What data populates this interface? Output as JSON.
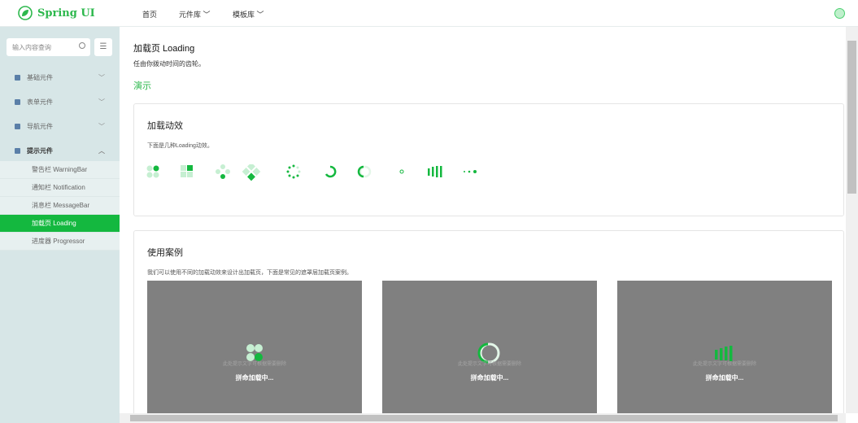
{
  "header": {
    "brand": "Spring UI",
    "nav": [
      {
        "label": "首页"
      },
      {
        "label": "元件库 ﹀"
      },
      {
        "label": "模板库 ﹀"
      }
    ]
  },
  "sidebar": {
    "search_placeholder": "输入内容查询",
    "groups": [
      {
        "label": "基础元件"
      },
      {
        "label": "表单元件"
      },
      {
        "label": "导航元件"
      },
      {
        "label": "提示元件"
      }
    ],
    "sub_items": [
      {
        "label": "警告栏 WarningBar"
      },
      {
        "label": "通知栏 Notification"
      },
      {
        "label": "消息栏 MessageBar"
      },
      {
        "label": "加载页 Loading"
      },
      {
        "label": "进度器 Progressor"
      }
    ]
  },
  "page": {
    "title": "加载页 Loading",
    "subtitle": "任由你拨动时间的齿轮。",
    "demo_label": "演示"
  },
  "card1": {
    "title": "加载动效",
    "desc": "下面是几种Loading动效。"
  },
  "card2": {
    "title": "使用案例",
    "desc": "我们可以使用不同的加载动效来设计出加载页，下面是常见的遮罩层加载页案例。",
    "panels": [
      {
        "tip": "此处提示文字可根据需要删除",
        "label": "拼命加载中..."
      },
      {
        "tip": "此处提示文字可根据需要删除",
        "label": "拼命加载中..."
      },
      {
        "tip": "此处提示文字可根据需要删除",
        "label": "拼命加载中..."
      }
    ]
  },
  "colors": {
    "accent": "#14b83f",
    "light": "#c6efd2",
    "sidebar": "#d7e6e7"
  }
}
